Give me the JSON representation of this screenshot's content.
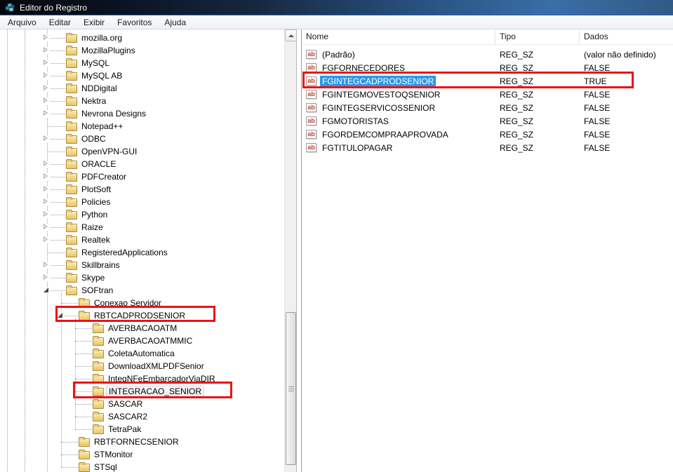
{
  "window": {
    "title": "Editor do Registro"
  },
  "menu": {
    "items": [
      "Arquivo",
      "Editar",
      "Exibir",
      "Favoritos",
      "Ajuda"
    ]
  },
  "tree": {
    "items": [
      {
        "label": "mozilla.org",
        "depth": 0,
        "expander": "collapsed"
      },
      {
        "label": "MozillaPlugins",
        "depth": 0,
        "expander": "collapsed"
      },
      {
        "label": "MySQL",
        "depth": 0,
        "expander": "collapsed"
      },
      {
        "label": "MySQL AB",
        "depth": 0,
        "expander": "collapsed"
      },
      {
        "label": "NDDigital",
        "depth": 0,
        "expander": "collapsed"
      },
      {
        "label": "Nektra",
        "depth": 0,
        "expander": "collapsed"
      },
      {
        "label": "Nevrona Designs",
        "depth": 0,
        "expander": "collapsed"
      },
      {
        "label": "Notepad++",
        "depth": 0,
        "expander": "none"
      },
      {
        "label": "ODBC",
        "depth": 0,
        "expander": "collapsed"
      },
      {
        "label": "OpenVPN-GUI",
        "depth": 0,
        "expander": "none"
      },
      {
        "label": "ORACLE",
        "depth": 0,
        "expander": "collapsed"
      },
      {
        "label": "PDFCreator",
        "depth": 0,
        "expander": "collapsed"
      },
      {
        "label": "PlotSoft",
        "depth": 0,
        "expander": "collapsed"
      },
      {
        "label": "Policies",
        "depth": 0,
        "expander": "collapsed"
      },
      {
        "label": "Python",
        "depth": 0,
        "expander": "collapsed"
      },
      {
        "label": "Raize",
        "depth": 0,
        "expander": "collapsed"
      },
      {
        "label": "Realtek",
        "depth": 0,
        "expander": "collapsed"
      },
      {
        "label": "RegisteredApplications",
        "depth": 0,
        "expander": "none"
      },
      {
        "label": "Skillbrains",
        "depth": 0,
        "expander": "collapsed"
      },
      {
        "label": "Skype",
        "depth": 0,
        "expander": "collapsed"
      },
      {
        "label": "SOFtran",
        "depth": 0,
        "expander": "expanded"
      },
      {
        "label": "Conexao Servidor",
        "depth": 1,
        "expander": "none"
      },
      {
        "label": "RBTCADPRODSENIOR",
        "depth": 1,
        "expander": "expanded",
        "annotated": true
      },
      {
        "label": "AVERBACAOATM",
        "depth": 2,
        "expander": "none"
      },
      {
        "label": "AVERBACAOATMMIC",
        "depth": 2,
        "expander": "none"
      },
      {
        "label": "ColetaAutomatica",
        "depth": 2,
        "expander": "none"
      },
      {
        "label": "DownloadXMLPDFSenior",
        "depth": 2,
        "expander": "none"
      },
      {
        "label": "IntegNFeEmbarcadorViaDIR",
        "depth": 2,
        "expander": "none"
      },
      {
        "label": "INTEGRACAO_SENIOR",
        "depth": 2,
        "expander": "none",
        "selected": true,
        "annotated": true
      },
      {
        "label": "SASCAR",
        "depth": 2,
        "expander": "none"
      },
      {
        "label": "SASCAR2",
        "depth": 2,
        "expander": "none"
      },
      {
        "label": "TetraPak",
        "depth": 2,
        "expander": "none"
      },
      {
        "label": "RBTFORNECSENIOR",
        "depth": 1,
        "expander": "none"
      },
      {
        "label": "STMonitor",
        "depth": 1,
        "expander": "none"
      },
      {
        "label": "STSql",
        "depth": 1,
        "expander": "none"
      }
    ]
  },
  "list": {
    "columns": [
      "Nome",
      "Tipo",
      "Dados"
    ],
    "rows": [
      {
        "name": "(Padrão)",
        "type": "REG_SZ",
        "data": "(valor não definido)"
      },
      {
        "name": "FGFORNECEDORES",
        "type": "REG_SZ",
        "data": "FALSE"
      },
      {
        "name": "FGINTEGCADPRODSENIOR",
        "type": "REG_SZ",
        "data": "TRUE",
        "selected": true
      },
      {
        "name": "FGINTEGMOVESTOQSENIOR",
        "type": "REG_SZ",
        "data": "FALSE"
      },
      {
        "name": "FGINTEGSERVICOSSENIOR",
        "type": "REG_SZ",
        "data": "FALSE"
      },
      {
        "name": "FGMOTORISTAS",
        "type": "REG_SZ",
        "data": "FALSE"
      },
      {
        "name": "FGORDEMCOMPRAAPROVADA",
        "type": "REG_SZ",
        "data": "FALSE"
      },
      {
        "name": "FGTITULOPAGAR",
        "type": "REG_SZ",
        "data": "FALSE"
      }
    ],
    "value_icon_text": "ab"
  },
  "colors": {
    "selection_blue": "#2e96e9",
    "annotation_red": "#ec1313",
    "titlebar_blue": "#3a6ea8",
    "folder_yellow": "#f4d98c"
  },
  "annotations": [
    {
      "target": "FGINTEGCADPRODSENIOR value row"
    },
    {
      "target": "RBTCADPRODSENIOR tree key"
    },
    {
      "target": "INTEGRACAO_SENIOR tree key"
    }
  ]
}
